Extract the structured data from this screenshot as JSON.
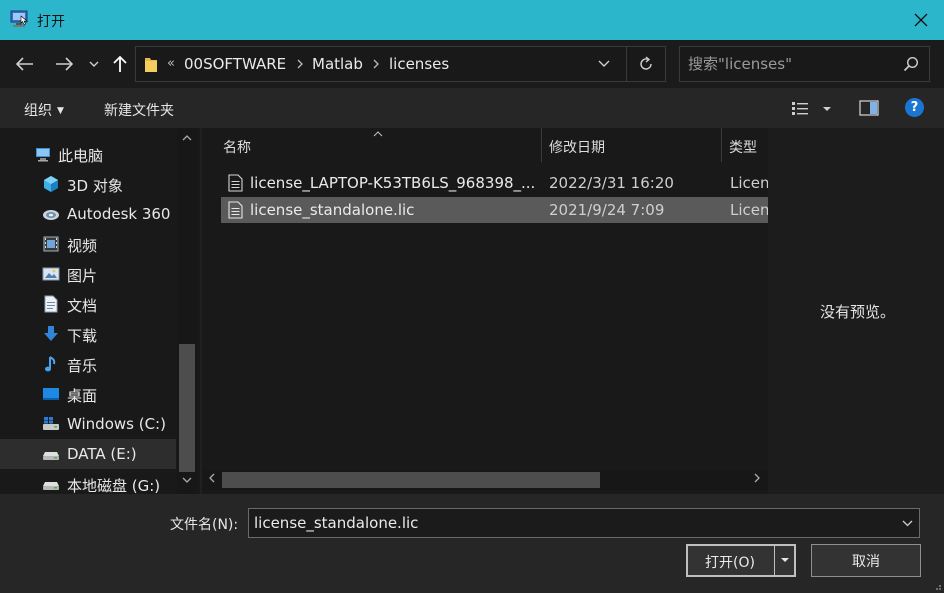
{
  "window": {
    "title": "打开",
    "accent_color": "#2bb6cc"
  },
  "nav": {
    "breadcrumb_overflow": "«",
    "breadcrumbs": [
      "00SOFTWARE",
      "Matlab",
      "licenses"
    ],
    "search_placeholder": "搜索\"licenses\""
  },
  "toolbar": {
    "organize_label": "组织",
    "new_folder_label": "新建文件夹"
  },
  "sidebar": {
    "items": [
      {
        "label": "此电脑",
        "icon": "computer-icon"
      },
      {
        "label": "3D 对象",
        "icon": "cube-3d-icon"
      },
      {
        "label": "Autodesk 360",
        "icon": "cloud-icon"
      },
      {
        "label": "视频",
        "icon": "video-icon"
      },
      {
        "label": "图片",
        "icon": "picture-icon"
      },
      {
        "label": "文档",
        "icon": "document-icon"
      },
      {
        "label": "下载",
        "icon": "download-icon"
      },
      {
        "label": "音乐",
        "icon": "music-icon"
      },
      {
        "label": "桌面",
        "icon": "desktop-icon"
      },
      {
        "label": "Windows (C:)",
        "icon": "drive-c-icon"
      },
      {
        "label": "DATA (E:)",
        "icon": "drive-icon"
      },
      {
        "label": "本地磁盘 (G:)",
        "icon": "drive-icon"
      }
    ]
  },
  "files": {
    "columns": {
      "name": "名称",
      "date": "修改日期",
      "type": "类型"
    },
    "rows": [
      {
        "name": "license_LAPTOP-K53TB6LS_968398_...",
        "date": "2022/3/31 16:20",
        "type": "Licen"
      },
      {
        "name": "license_standalone.lic",
        "date": "2021/9/24 7:09",
        "type": "Licen"
      }
    ]
  },
  "preview": {
    "empty_text": "没有预览。"
  },
  "bottom": {
    "filename_label": "文件名(N):",
    "filename_value": "license_standalone.lic",
    "open_label": "打开(O)",
    "cancel_label": "取消"
  }
}
